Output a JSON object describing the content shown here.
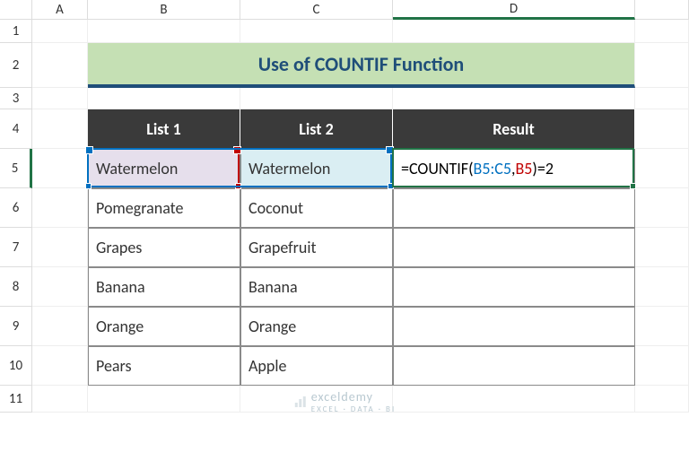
{
  "columns": [
    "A",
    "B",
    "C",
    "D"
  ],
  "selected_column": "D",
  "rows": [
    "1",
    "2",
    "3",
    "4",
    "5",
    "6",
    "7",
    "8",
    "9",
    "10",
    "11"
  ],
  "selected_row": "5",
  "title": "Use of COUNTIF Function",
  "headers": {
    "b": "List 1",
    "c": "List 2",
    "d": "Result"
  },
  "data": {
    "r5": {
      "b": "Watermelon",
      "c": "Watermelon"
    },
    "r6": {
      "b": "Pomegranate",
      "c": "Coconut"
    },
    "r7": {
      "b": "Grapes",
      "c": "Grapefruit"
    },
    "r8": {
      "b": "Banana",
      "c": "Banana"
    },
    "r9": {
      "b": "Orange",
      "c": "Orange"
    },
    "r10": {
      "b": "Pears",
      "c": "Apple"
    }
  },
  "formula": {
    "eq": "=",
    "fn": "COUNTIF(",
    "range": "B5:C5",
    "comma": ",",
    "criteria": "B5",
    "close": ")",
    "tail": "=2"
  },
  "watermark": {
    "name": "exceldemy",
    "tag": "EXCEL · DATA · BI"
  },
  "chart_data": {
    "type": "table",
    "title": "Use of COUNTIF Function",
    "columns": [
      "List 1",
      "List 2",
      "Result"
    ],
    "rows": [
      [
        "Watermelon",
        "Watermelon",
        "=COUNTIF(B5:C5,B5)=2"
      ],
      [
        "Pomegranate",
        "Coconut",
        ""
      ],
      [
        "Grapes",
        "Grapefruit",
        ""
      ],
      [
        "Banana",
        "Banana",
        ""
      ],
      [
        "Orange",
        "Orange",
        ""
      ],
      [
        "Pears",
        "Apple",
        ""
      ]
    ]
  }
}
